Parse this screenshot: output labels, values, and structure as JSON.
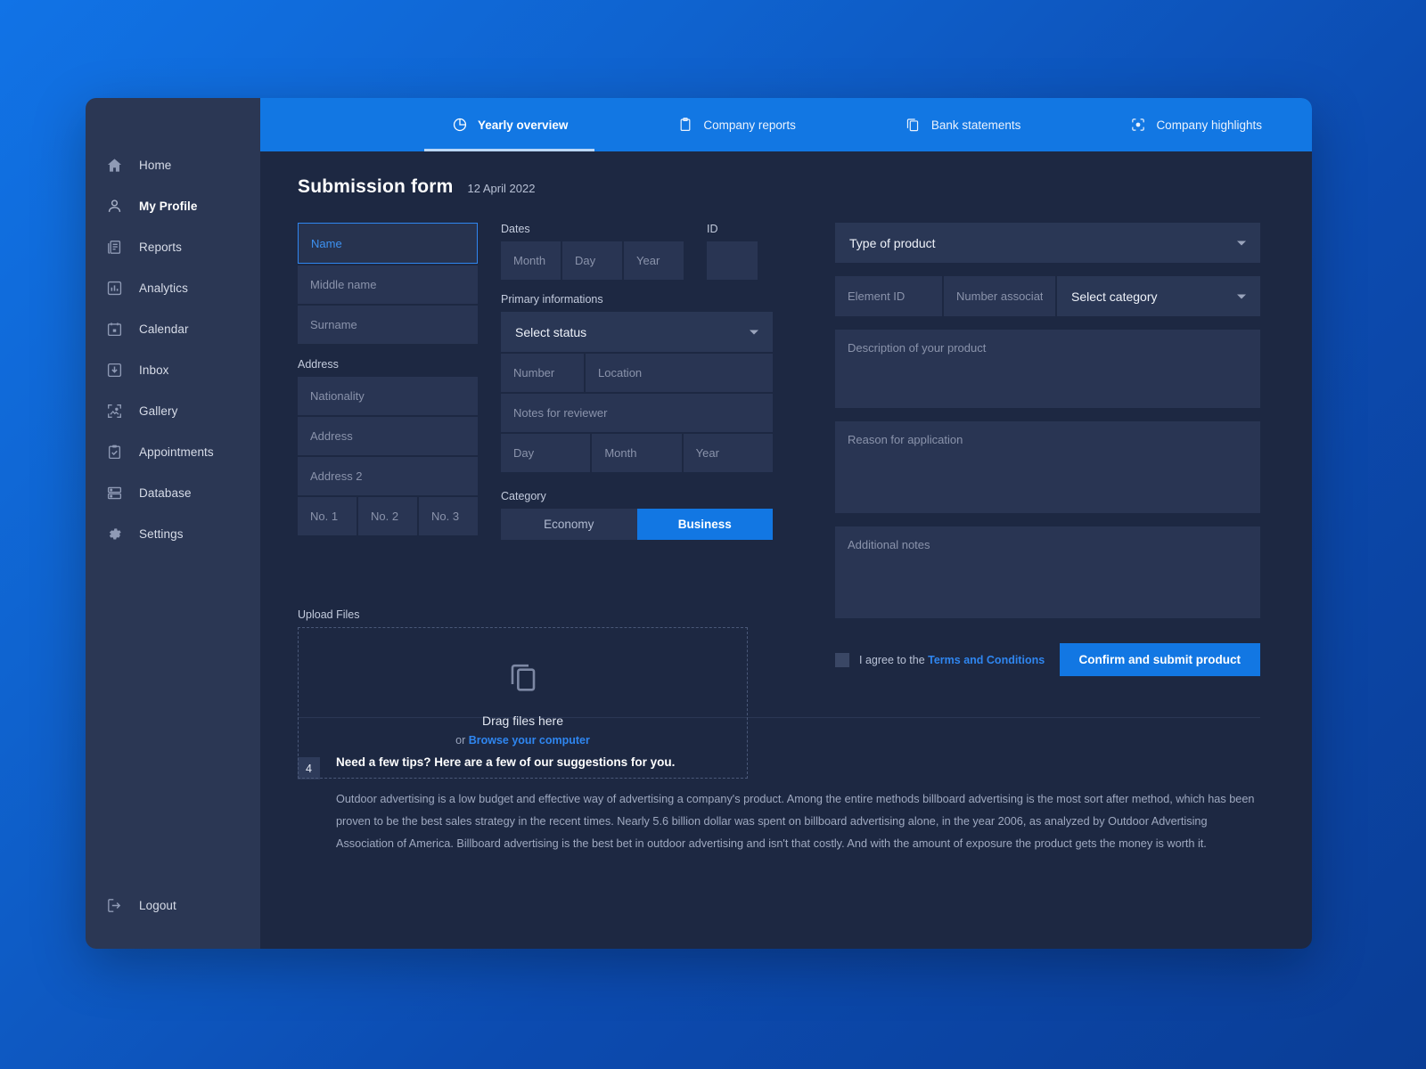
{
  "sidebar": {
    "items": [
      {
        "label": "Home",
        "icon": "home-icon",
        "active": false
      },
      {
        "label": "My Profile",
        "icon": "user-icon",
        "active": true
      },
      {
        "label": "Reports",
        "icon": "report-document-icon",
        "active": false
      },
      {
        "label": "Analytics",
        "icon": "bar-chart-icon",
        "active": false
      },
      {
        "label": "Calendar",
        "icon": "calendar-icon",
        "active": false
      },
      {
        "label": "Inbox",
        "icon": "inbox-download-icon",
        "active": false
      },
      {
        "label": "Gallery",
        "icon": "image-icon",
        "active": false
      },
      {
        "label": "Appointments",
        "icon": "clipboard-check-icon",
        "active": false
      },
      {
        "label": "Database",
        "icon": "database-icon",
        "active": false
      },
      {
        "label": "Settings",
        "icon": "gear-icon",
        "active": false
      }
    ],
    "logout": {
      "label": "Logout",
      "icon": "logout-icon"
    }
  },
  "tabs": [
    {
      "label": "Yearly overview",
      "icon": "pie-chart-icon",
      "active": true
    },
    {
      "label": "Company reports",
      "icon": "clipboard-icon",
      "active": false
    },
    {
      "label": "Bank statements",
      "icon": "copy-documents-icon",
      "active": false
    },
    {
      "label": "Company highlights",
      "icon": "focus-target-icon",
      "active": false
    }
  ],
  "header": {
    "title": "Submission form",
    "date": "12 April 2022"
  },
  "form": {
    "name": {
      "placeholder": "Name",
      "value": ""
    },
    "middle_name": {
      "placeholder": "Middle name",
      "value": ""
    },
    "surname": {
      "placeholder": "Surname",
      "value": ""
    },
    "address_label": "Address",
    "nationality": {
      "placeholder": "Nationality",
      "value": ""
    },
    "address1": {
      "placeholder": "Address",
      "value": ""
    },
    "address2": {
      "placeholder": "Address 2",
      "value": ""
    },
    "no1": {
      "placeholder": "No. 1",
      "value": ""
    },
    "no2": {
      "placeholder": "No. 2",
      "value": ""
    },
    "no3": {
      "placeholder": "No. 3",
      "value": ""
    },
    "upload_label": "Upload Files",
    "dropzone": {
      "main": "Drag files here",
      "prefix": "or ",
      "link": "Browse your computer"
    },
    "dates_label": "Dates",
    "date_month": {
      "placeholder": "Month",
      "value": ""
    },
    "date_day": {
      "placeholder": "Day",
      "value": ""
    },
    "date_year": {
      "placeholder": "Year",
      "value": ""
    },
    "id_label": "ID",
    "id_field": {
      "placeholder": "",
      "value": ""
    },
    "primary_label": "Primary informations",
    "status_select": {
      "value": "Select status"
    },
    "number": {
      "placeholder": "Number",
      "value": ""
    },
    "location": {
      "placeholder": "Location",
      "value": ""
    },
    "notes_reviewer": {
      "placeholder": "Notes for reviewer",
      "value": ""
    },
    "sec_day": {
      "placeholder": "Day",
      "value": ""
    },
    "sec_month": {
      "placeholder": "Month",
      "value": ""
    },
    "sec_year": {
      "placeholder": "Year",
      "value": ""
    },
    "category_label": "Category",
    "category_options": [
      {
        "label": "Economy",
        "selected": false
      },
      {
        "label": "Business",
        "selected": true
      }
    ],
    "type_of_product": {
      "value": "Type of product"
    },
    "element_id": {
      "placeholder": "Element ID",
      "value": ""
    },
    "number_associated": {
      "placeholder": "Number associated",
      "value": ""
    },
    "select_category": {
      "value": "Select category"
    },
    "description": {
      "placeholder": "Description of your product",
      "value": ""
    },
    "reason": {
      "placeholder": "Reason for application",
      "value": ""
    },
    "additional_notes": {
      "placeholder": "Additional notes",
      "value": ""
    },
    "agree_prefix": "I agree to the ",
    "agree_link": "Terms and Conditions",
    "submit_label": "Confirm and submit product"
  },
  "tips": {
    "badge": "4",
    "title": "Need a few tips? Here are a few of our suggestions for you.",
    "text": "Outdoor advertising is a low budget and effective way of advertising a company's product. Among the entire methods billboard advertising is the most sort after method, which has been proven to be the best sales strategy in the recent times. Nearly 5.6 billion dollar was spent on billboard advertising alone, in the year 2006, as analyzed by Outdoor Advertising Association of America. Billboard advertising is the best bet in outdoor advertising and isn't that costly. And with the amount of exposure the product gets the money is worth it."
  },
  "colors": {
    "accent": "#1277e3",
    "card_bg": "#1d2842",
    "sidebar_bg": "#2b3754",
    "field_bg": "#293553",
    "link": "#2f86f0"
  }
}
